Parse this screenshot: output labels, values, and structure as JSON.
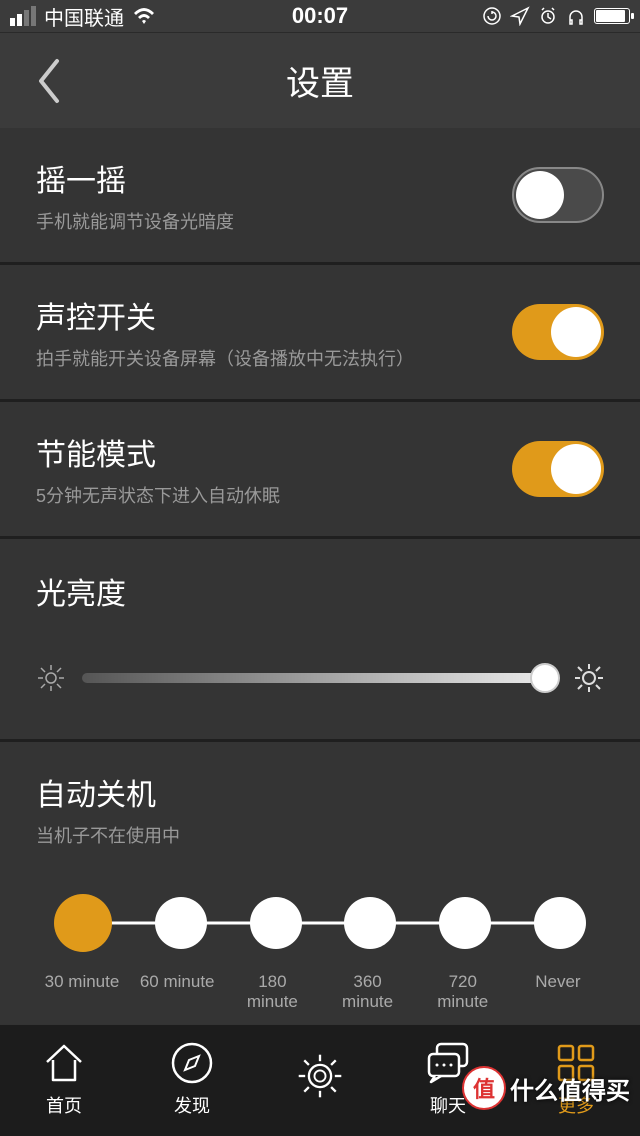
{
  "status": {
    "carrier": "中国联通",
    "time": "00:07"
  },
  "nav": {
    "title": "设置"
  },
  "settings": {
    "shake": {
      "title": "摇一摇",
      "desc": "手机就能调节设备光暗度",
      "on": false
    },
    "voice": {
      "title": "声控开关",
      "desc": "拍手就能开关设备屏幕（设备播放中无法执行）",
      "on": true
    },
    "eco": {
      "title": "节能模式",
      "desc": "5分钟无声状态下进入自动休眠",
      "on": true
    }
  },
  "brightness": {
    "title": "光亮度",
    "value": 100
  },
  "autopower": {
    "title": "自动关机",
    "desc": "当机子不在使用中",
    "options": [
      "30 minute",
      "60 minute",
      "180 minute",
      "360 minute",
      "720 minute",
      "Never"
    ],
    "selected": 0
  },
  "tabs": {
    "home": "首页",
    "discover": "发现",
    "light": "",
    "chat": "聊天",
    "more": "更多"
  },
  "watermark": {
    "badge": "值",
    "text": "什么值得买"
  }
}
